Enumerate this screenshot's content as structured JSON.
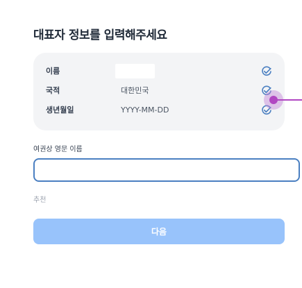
{
  "page": {
    "title": "대표자 정보를 입력해주세요"
  },
  "info_card": {
    "rows": [
      {
        "label": "이름",
        "value": "",
        "icon": "check-circle-icon"
      },
      {
        "label": "국적",
        "value": "대한민국",
        "icon": "check-circle-icon"
      },
      {
        "label": "생년월일",
        "value": "YYYY-MM-DD",
        "icon": "check-circle-icon"
      }
    ]
  },
  "english_name_field": {
    "label": "여권상 영문 이름",
    "value": "",
    "placeholder": ""
  },
  "recommend": {
    "label": "추천"
  },
  "next_button": {
    "label": "다음"
  },
  "colors": {
    "accent": "#4a7fc1",
    "button_disabled": "#98c3fb",
    "card_background": "#f3f4f6",
    "cursor": "#b146c2"
  }
}
